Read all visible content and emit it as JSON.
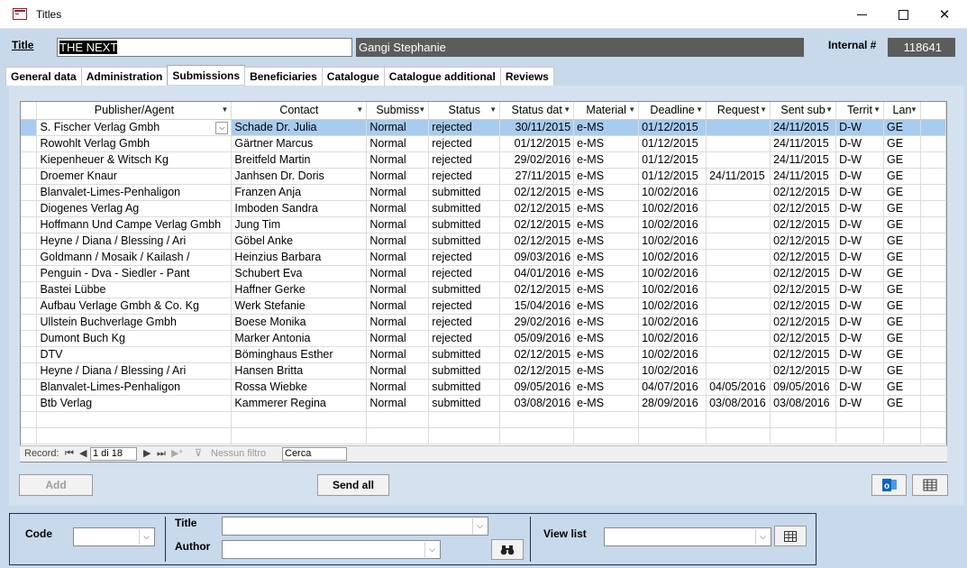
{
  "window": {
    "title": "Titles"
  },
  "header": {
    "title_label": "Title",
    "title_value": "THE NEXT",
    "author_value": "Gangi Stephanie",
    "internal_label": "Internal #",
    "internal_value": "118641"
  },
  "tabs": [
    {
      "label": "General data"
    },
    {
      "label": "Administration"
    },
    {
      "label": "Submissions"
    },
    {
      "label": "Beneficiaries"
    },
    {
      "label": "Catalogue"
    },
    {
      "label": "Catalogue additional"
    },
    {
      "label": "Reviews"
    }
  ],
  "active_tab": "Submissions",
  "grid": {
    "columns": [
      "Publisher/Agent",
      "Contact",
      "Submiss",
      "Status",
      "Status dat",
      "Material",
      "Deadline",
      "Request",
      "Sent sub",
      "Territ",
      "Lan"
    ],
    "rows": [
      [
        "S. Fischer Verlag Gmbh",
        "Schade Dr. Julia",
        "Normal",
        "rejected",
        "30/11/2015",
        "e-MS",
        "01/12/2015",
        "",
        "24/11/2015",
        "D-W",
        "GE"
      ],
      [
        "Rowohlt Verlag Gmbh",
        "Gärtner Marcus",
        "Normal",
        "rejected",
        "01/12/2015",
        "e-MS",
        "01/12/2015",
        "",
        "24/11/2015",
        "D-W",
        "GE"
      ],
      [
        "Kiepenheuer & Witsch Kg",
        "Breitfeld Martin",
        "Normal",
        "rejected",
        "29/02/2016",
        "e-MS",
        "01/12/2015",
        "",
        "24/11/2015",
        "D-W",
        "GE"
      ],
      [
        "Droemer Knaur",
        "Janhsen Dr. Doris",
        "Normal",
        "rejected",
        "27/11/2015",
        "e-MS",
        "01/12/2015",
        "24/11/2015",
        "24/11/2015",
        "D-W",
        "GE"
      ],
      [
        "Blanvalet-Limes-Penhaligon",
        "Franzen Anja",
        "Normal",
        "submitted",
        "02/12/2015",
        "e-MS",
        "10/02/2016",
        "",
        "02/12/2015",
        "D-W",
        "GE"
      ],
      [
        "Diogenes Verlag Ag",
        "Imboden Sandra",
        "Normal",
        "submitted",
        "02/12/2015",
        "e-MS",
        "10/02/2016",
        "",
        "02/12/2015",
        "D-W",
        "GE"
      ],
      [
        "Hoffmann Und Campe Verlag Gmbh",
        "Jung Tim",
        "Normal",
        "submitted",
        "02/12/2015",
        "e-MS",
        "10/02/2016",
        "",
        "02/12/2015",
        "D-W",
        "GE"
      ],
      [
        "Heyne / Diana / Blessing / Ari",
        "Göbel Anke",
        "Normal",
        "submitted",
        "02/12/2015",
        "e-MS",
        "10/02/2016",
        "",
        "02/12/2015",
        "D-W",
        "GE"
      ],
      [
        "Goldmann / Mosaik / Kailash /",
        "Heinzius Barbara",
        "Normal",
        "rejected",
        "09/03/2016",
        "e-MS",
        "10/02/2016",
        "",
        "02/12/2015",
        "D-W",
        "GE"
      ],
      [
        "Penguin - Dva - Siedler - Pant",
        "Schubert Eva",
        "Normal",
        "rejected",
        "04/01/2016",
        "e-MS",
        "10/02/2016",
        "",
        "02/12/2015",
        "D-W",
        "GE"
      ],
      [
        "Bastei Lübbe",
        "Haffner Gerke",
        "Normal",
        "submitted",
        "02/12/2015",
        "e-MS",
        "10/02/2016",
        "",
        "02/12/2015",
        "D-W",
        "GE"
      ],
      [
        "Aufbau Verlage Gmbh & Co. Kg",
        "Werk Stefanie",
        "Normal",
        "rejected",
        "15/04/2016",
        "e-MS",
        "10/02/2016",
        "",
        "02/12/2015",
        "D-W",
        "GE"
      ],
      [
        "Ullstein Buchverlage Gmbh",
        "Boese Monika",
        "Normal",
        "rejected",
        "29/02/2016",
        "e-MS",
        "10/02/2016",
        "",
        "02/12/2015",
        "D-W",
        "GE"
      ],
      [
        "Dumont Buch Kg",
        "Marker Antonia",
        "Normal",
        "rejected",
        "05/09/2016",
        "e-MS",
        "10/02/2016",
        "",
        "02/12/2015",
        "D-W",
        "GE"
      ],
      [
        "DTV",
        "Böminghaus Esther",
        "Normal",
        "submitted",
        "02/12/2015",
        "e-MS",
        "10/02/2016",
        "",
        "02/12/2015",
        "D-W",
        "GE"
      ],
      [
        "Heyne / Diana / Blessing / Ari",
        "Hansen Britta",
        "Normal",
        "submitted",
        "02/12/2015",
        "e-MS",
        "10/02/2016",
        "",
        "02/12/2015",
        "D-W",
        "GE"
      ],
      [
        "Blanvalet-Limes-Penhaligon",
        "Rossa Wiebke",
        "Normal",
        "submitted",
        "09/05/2016",
        "e-MS",
        "04/07/2016",
        "04/05/2016",
        "09/05/2016",
        "D-W",
        "GE"
      ],
      [
        "Btb Verlag",
        "Kammerer Regina",
        "Normal",
        "submitted",
        "03/08/2016",
        "e-MS",
        "28/09/2016",
        "03/08/2016",
        "03/08/2016",
        "D-W",
        "GE"
      ]
    ]
  },
  "navigation": {
    "record_label": "Record:",
    "record_position": "1 di 18",
    "filter_label": "Nessun filtro",
    "search_label": "Cerca"
  },
  "actions": {
    "add_label": "Add",
    "send_all_label": "Send all"
  },
  "search_panel": {
    "code_label": "Code",
    "title_label": "Title",
    "author_label": "Author",
    "view_list_label": "View list"
  },
  "colors": {
    "background": "#c7d9ea",
    "selected_row": "#a8ccef",
    "outlook_blue": "#0b64c0"
  }
}
